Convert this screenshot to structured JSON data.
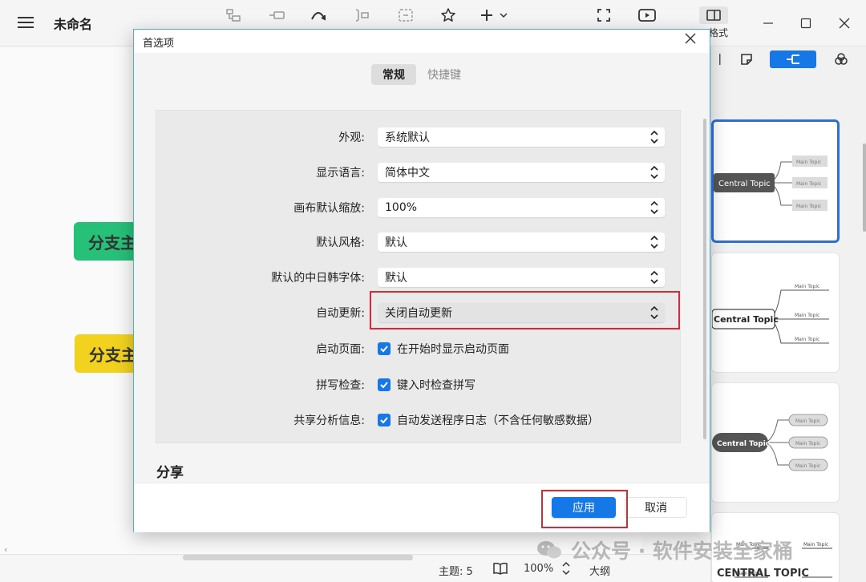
{
  "app": {
    "doc_title": "未命名",
    "format_label": "格式"
  },
  "canvas": {
    "branch_green": "分支主",
    "branch_yellow": "分支主"
  },
  "status": {
    "topics": "主题: 5",
    "zoom": "100%",
    "outline": "大纲"
  },
  "watermark": "公众号 · 软件安装全家桶",
  "panel": {
    "cards": [
      {
        "central": "Central Topic",
        "branches": [
          "Main Topic",
          "Main Topic",
          "Main Topic"
        ]
      },
      {
        "central": "Central Topic",
        "branches": [
          "Main Topic",
          "Main Topic",
          "Main Topic"
        ]
      },
      {
        "central": "Central Topic",
        "branches": [
          "Main Topic",
          "Main Topic",
          "Main Topic"
        ]
      },
      {
        "central": "CENTRAL TOPIC",
        "branches": [
          "Main Topic",
          "Main Topic",
          "Main Topic"
        ]
      }
    ]
  },
  "dialog": {
    "title": "首选项",
    "tabs": [
      "常规",
      "快捷键"
    ],
    "rows": [
      {
        "label": "外观:",
        "value": "系统默认"
      },
      {
        "label": "显示语言:",
        "value": "简体中文"
      },
      {
        "label": "画布默认缩放:",
        "value": "100%"
      },
      {
        "label": "默认风格:",
        "value": "默认"
      },
      {
        "label": "默认的中日韩字体:",
        "value": "默认"
      },
      {
        "label": "自动更新:",
        "value": "关闭自动更新"
      }
    ],
    "checks": [
      {
        "label": "启动页面:",
        "text": "在开始时显示启动页面",
        "checked": true
      },
      {
        "label": "拼写检查:",
        "text": "键入时检查拼写",
        "checked": true
      },
      {
        "label": "共享分析信息:",
        "text": "自动发送程序日志（不含任何敏感数据）",
        "checked": true
      }
    ],
    "section_share": "分享",
    "apply": "应用",
    "cancel": "取消"
  },
  "colors": {
    "accent": "#1677e6",
    "highlight": "#d42a3a",
    "branch_green": "#27c079",
    "branch_yellow": "#f2d21f"
  }
}
